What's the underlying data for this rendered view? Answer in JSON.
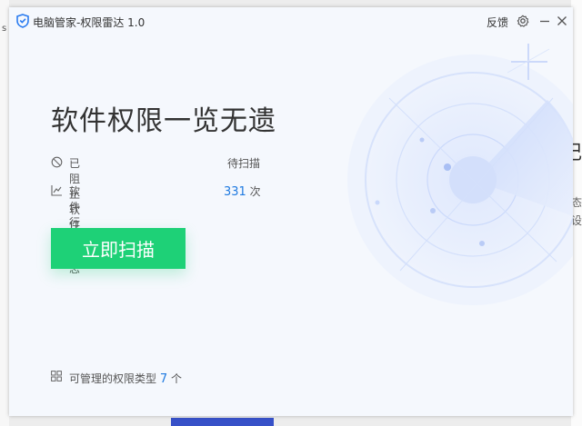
{
  "background": {
    "left_fragment": "s",
    "right_fragments": [
      "记",
      "态",
      "设"
    ]
  },
  "window": {
    "title": "电脑管家-权限雷达 1.0",
    "feedback_label": "反馈",
    "icons": [
      "shield-icon",
      "gear-icon",
      "minimize-icon",
      "close-icon"
    ]
  },
  "main": {
    "headline": "软件权限一览无遗",
    "blocked": {
      "label": "已阻止软件",
      "status": "待扫描"
    },
    "log": {
      "label": "软件行为日志",
      "count": "331",
      "unit": "次"
    },
    "scan_button": "立即扫描",
    "footer": {
      "prefix": "可管理的权限类型",
      "count": "7",
      "unit": "个"
    }
  },
  "colors": {
    "accent_green": "#1ed177",
    "link_blue": "#1f7ae0",
    "radar_blue": "#c6d6fb"
  }
}
